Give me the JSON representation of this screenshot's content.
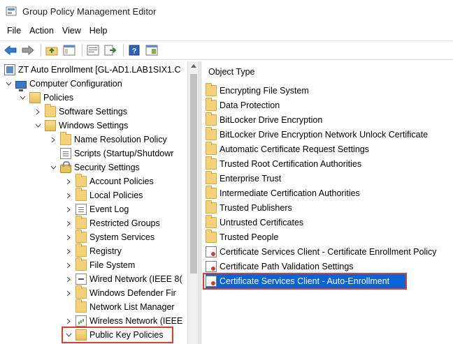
{
  "window": {
    "title": "Group Policy Management Editor"
  },
  "menu": [
    "File",
    "Action",
    "View",
    "Help"
  ],
  "toolbar": {
    "buttons": [
      "back-icon",
      "forward-icon",
      "up-folder-icon",
      "show-hide-tree-icon",
      "properties-icon",
      "export-list-icon",
      "help-icon",
      "console-view-icon"
    ]
  },
  "tree": {
    "root": "ZT Auto Enrollment [GL-AD1.LAB1SIX1.C",
    "computer_configuration": "Computer Configuration",
    "policies": "Policies",
    "software_settings": "Software Settings",
    "windows_settings": "Windows Settings",
    "name_resolution_policy": "Name Resolution Policy",
    "scripts": "Scripts (Startup/Shutdowr",
    "security_settings": "Security Settings",
    "account_policies": "Account Policies",
    "local_policies": "Local Policies",
    "event_log": "Event Log",
    "restricted_groups": "Restricted Groups",
    "system_services": "System Services",
    "registry": "Registry",
    "file_system": "File System",
    "wired_network": "Wired Network (IEEE 8(",
    "windows_defender": "Windows Defender Fir",
    "network_list_manager": "Network List Manager",
    "wireless_network": "Wireless Network (IEEE",
    "public_key_policies": "Public Key Policies"
  },
  "list": {
    "header": "Object Type",
    "items": [
      "Encrypting File System",
      "Data Protection",
      "BitLocker Drive Encryption",
      "BitLocker Drive Encryption Network Unlock Certificate",
      "Automatic Certificate Request Settings",
      "Trusted Root Certification Authorities",
      "Enterprise Trust",
      "Intermediate Certification Authorities",
      "Trusted Publishers",
      "Untrusted Certificates",
      "Trusted People",
      "Certificate Services Client - Certificate Enrollment Policy",
      "Certificate Path Validation Settings",
      "Certificate Services Client - Auto-Enrollment"
    ],
    "selected_index": 13
  },
  "colors": {
    "selection": "#0a64d8",
    "highlight_border": "#e23a2e",
    "folder": "#f4d27a"
  }
}
